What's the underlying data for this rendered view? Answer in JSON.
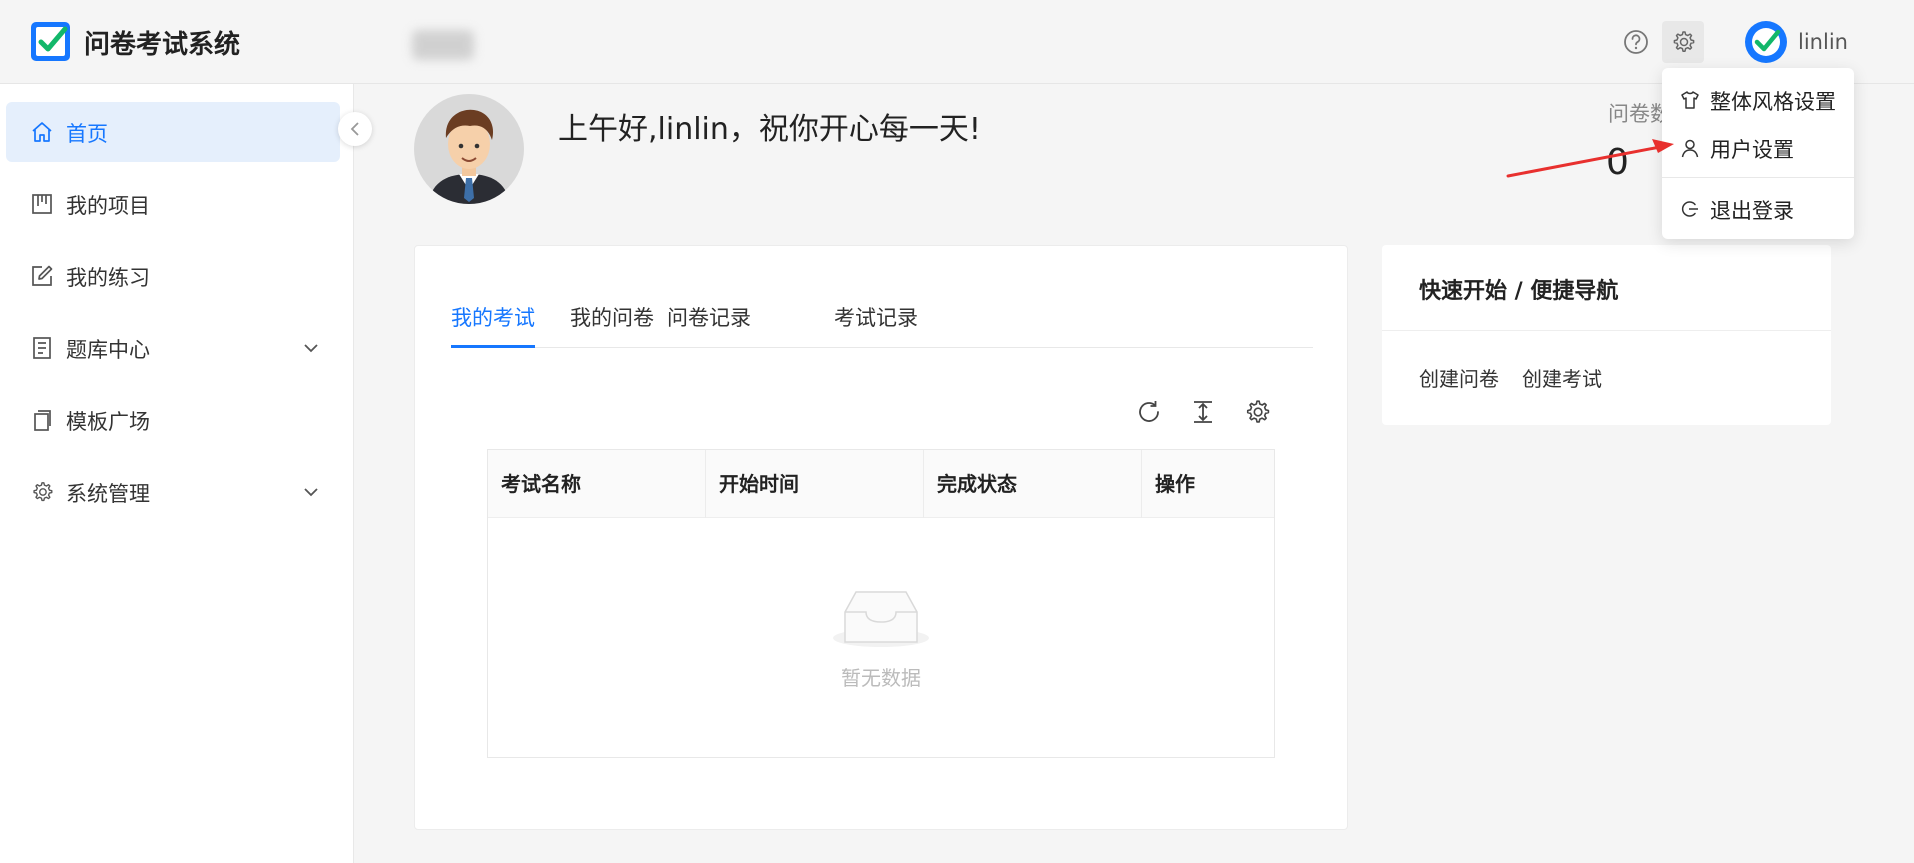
{
  "app": {
    "title": "问卷考试系统",
    "username": "linlin"
  },
  "sidebar": {
    "items": [
      {
        "label": "首页",
        "icon": "home-icon",
        "active": true
      },
      {
        "label": "我的项目",
        "icon": "project-icon"
      },
      {
        "label": "我的练习",
        "icon": "edit-icon"
      },
      {
        "label": "题库中心",
        "icon": "book-icon",
        "has_children": true
      },
      {
        "label": "模板广场",
        "icon": "copy-icon"
      },
      {
        "label": "系统管理",
        "icon": "gear-icon",
        "has_children": true
      }
    ]
  },
  "greeting": {
    "text": "上午好,linlin，祝你开心每一天!"
  },
  "stats": {
    "label": "问卷数",
    "value": "0"
  },
  "tabs": [
    "我的考试",
    "我的问卷",
    "问卷记录",
    "考试记录"
  ],
  "table": {
    "columns": [
      "考试名称",
      "开始时间",
      "完成状态",
      "操作"
    ],
    "empty_text": "暂无数据"
  },
  "quick_nav": {
    "title": "快速开始 / 便捷导航",
    "links": [
      "创建问卷",
      "创建考试"
    ]
  },
  "settings_menu": {
    "items": [
      "整体风格设置",
      "用户设置",
      "退出登录"
    ]
  },
  "colors": {
    "primary": "#1677ff",
    "annotation_arrow": "#e8302e"
  }
}
